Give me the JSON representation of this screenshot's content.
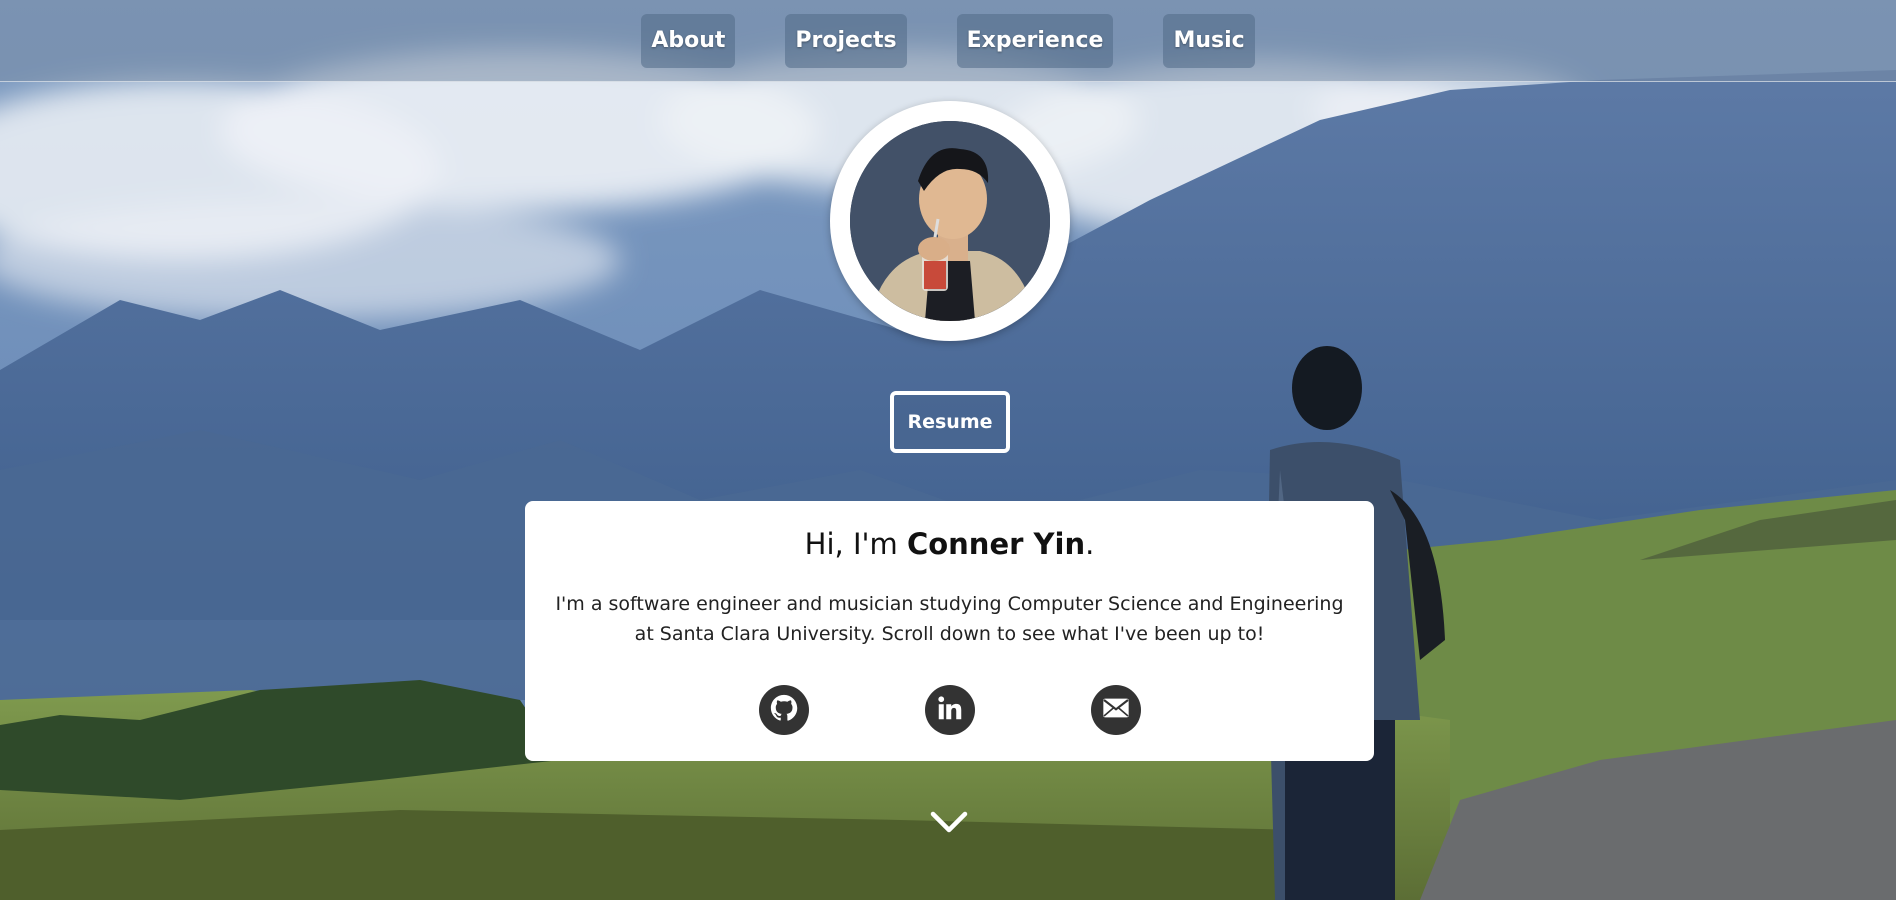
{
  "nav": {
    "items": [
      {
        "label": "About"
      },
      {
        "label": "Projects"
      },
      {
        "label": "Experience"
      },
      {
        "label": "Music"
      }
    ]
  },
  "hero": {
    "resume_label": "Resume",
    "greeting_prefix": "Hi, I'm",
    "name": "Conner Yin",
    "greeting_suffix": ".",
    "bio": "I'm a software engineer and musician studying Computer Science and Engineering at Santa Clara University. Scroll down to see what I've been up to!"
  },
  "socials": [
    {
      "icon": "github-icon"
    },
    {
      "icon": "linkedin-icon"
    },
    {
      "icon": "email-icon"
    }
  ],
  "scroll_icon": "chevron-down-icon",
  "colors": {
    "card_bg": "#ffffff",
    "social_bg": "#333333",
    "nav_text": "#ffffff"
  }
}
